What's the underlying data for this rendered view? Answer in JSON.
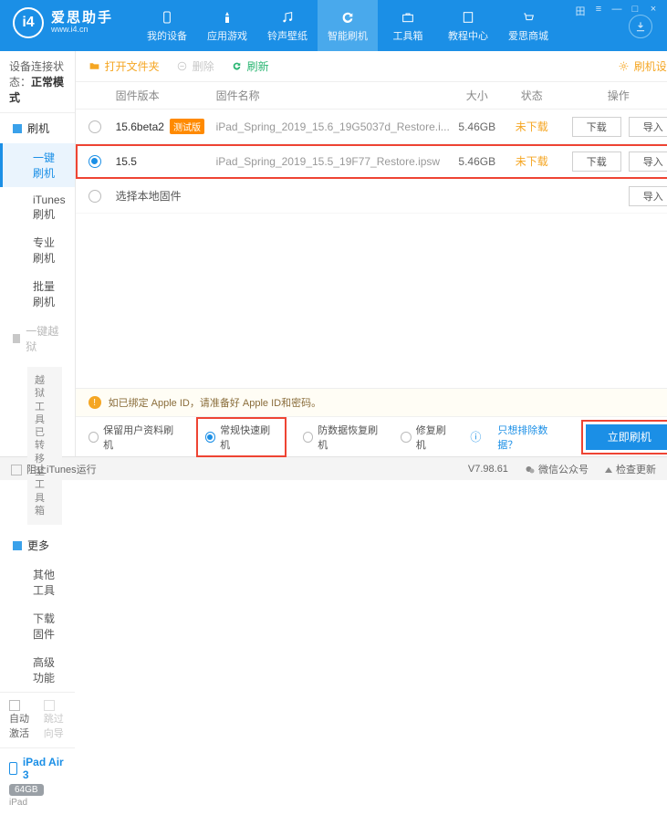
{
  "app": {
    "name": "爱思助手",
    "site": "www.i4.cn",
    "logo_letter": "i4"
  },
  "win": [
    "田",
    "≡",
    "—",
    "□",
    "×"
  ],
  "nav": [
    {
      "label": "我的设备"
    },
    {
      "label": "应用游戏"
    },
    {
      "label": "铃声壁纸"
    },
    {
      "label": "智能刷机"
    },
    {
      "label": "工具箱"
    },
    {
      "label": "教程中心"
    },
    {
      "label": "爱思商城"
    }
  ],
  "conn": {
    "prefix": "设备连接状态：",
    "value": "正常模式"
  },
  "sidebar": {
    "g1": {
      "head": "刷机",
      "items": [
        "一键刷机",
        "iTunes刷机",
        "专业刷机",
        "批量刷机"
      ]
    },
    "g2": {
      "head": "一键越狱",
      "moved": "越狱工具已转移至工具箱"
    },
    "g3": {
      "head": "更多",
      "items": [
        "其他工具",
        "下载固件",
        "高级功能"
      ]
    },
    "auto": "自动激活",
    "skip": "跳过向导"
  },
  "device": {
    "name": "iPad Air 3",
    "capacity": "64GB",
    "type": "iPad"
  },
  "toolbar": {
    "open": "打开文件夹",
    "delete": "删除",
    "refresh": "刷新",
    "settings": "刷机设置"
  },
  "thead": {
    "ver": "固件版本",
    "name": "固件名称",
    "size": "大小",
    "state": "状态",
    "ops": "操作"
  },
  "rows": [
    {
      "ver": "15.6beta2",
      "badge": "测试版",
      "name": "iPad_Spring_2019_15.6_19G5037d_Restore.i...",
      "size": "5.46GB",
      "state": "未下载"
    },
    {
      "ver": "15.5",
      "name": "iPad_Spring_2019_15.5_19F77_Restore.ipsw",
      "size": "5.46GB",
      "state": "未下载"
    }
  ],
  "local_row": "选择本地固件",
  "btns": {
    "download": "下载",
    "import": "导入"
  },
  "notice": "如已绑定 Apple ID，请准备好 Apple ID和密码。",
  "modes": {
    "keep": "保留用户资料刷机",
    "fast": "常规快速刷机",
    "recover": "防数据恢复刷机",
    "repair": "修复刷机",
    "exclude": "只想排除数据？",
    "flash": "立即刷机"
  },
  "footer": {
    "block": "阻止iTunes运行",
    "ver": "V7.98.61",
    "wechat": "微信公众号",
    "check": "检查更新"
  }
}
